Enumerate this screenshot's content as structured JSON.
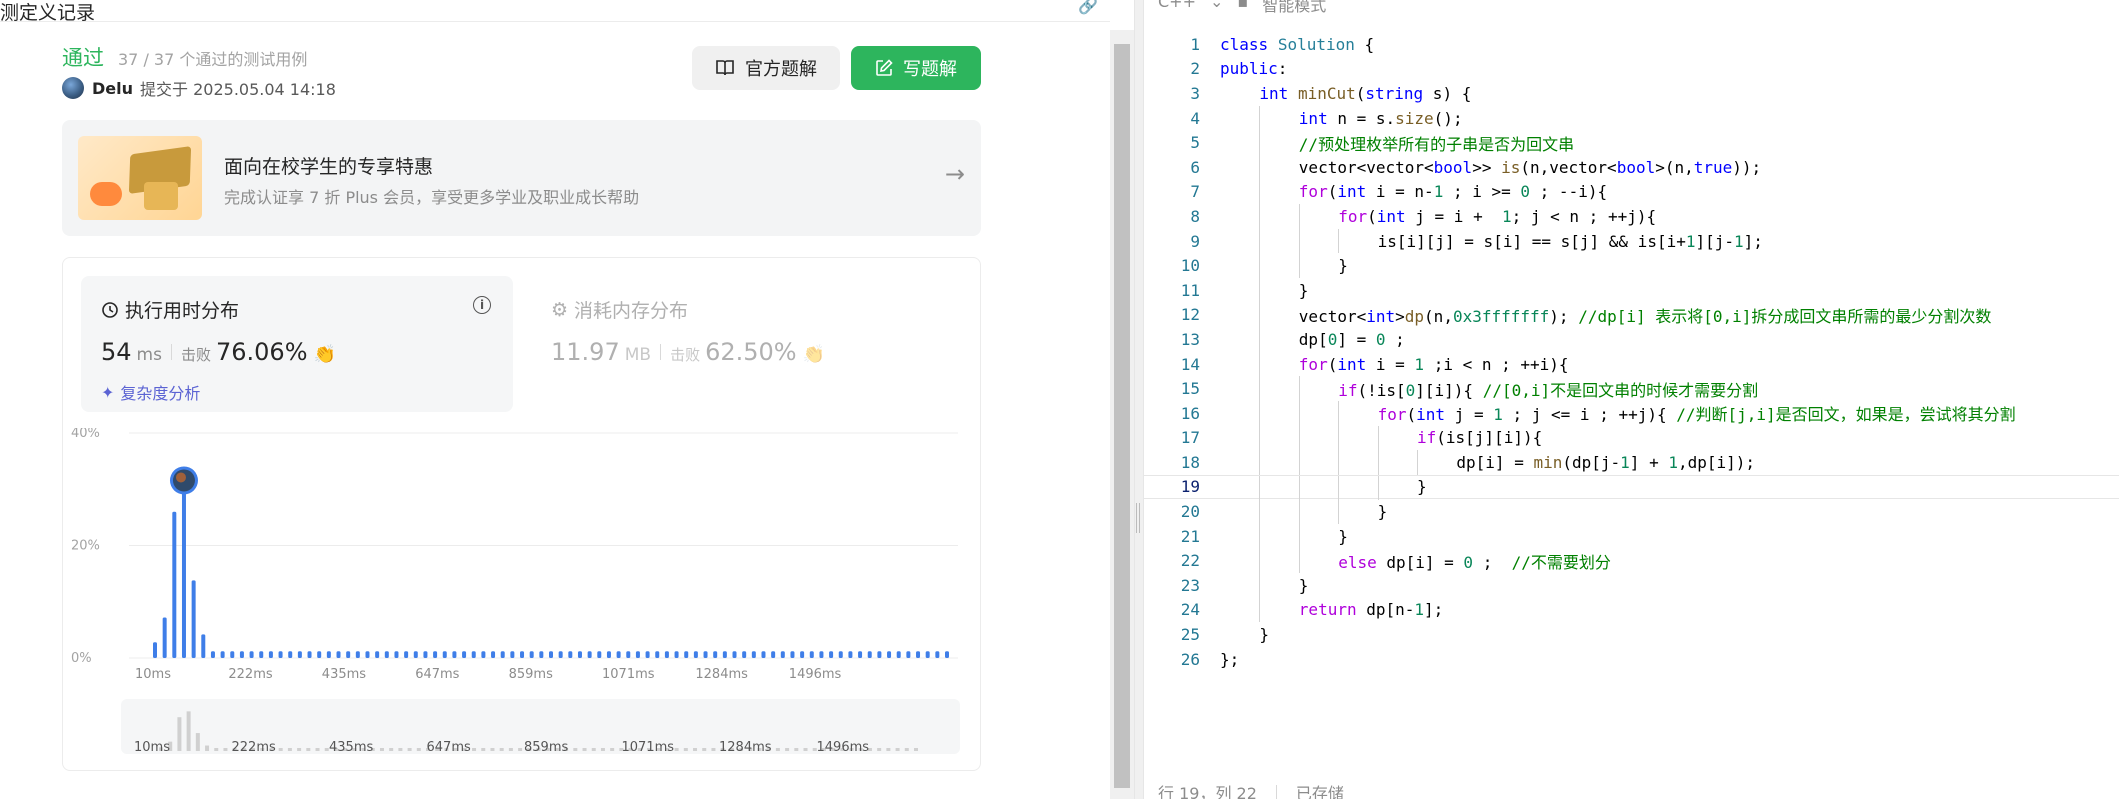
{
  "left": {
    "title": "测定义记录",
    "status": "通过",
    "cases": "37 / 37 个通过的测试用例",
    "user": "Delu",
    "submitted": "提交于 2025.05.04 14:18",
    "btn_official": "官方题解",
    "btn_write": "写题解",
    "promo_title": "面向在校学生的专享特惠",
    "promo_sub": "完成认证享 7 折 Plus 会员，享受更多学业及职业成长帮助",
    "runtime_title": "执行用时分布",
    "runtime_value": "54",
    "runtime_unit": "ms",
    "beat_label": "击败",
    "runtime_beat": "76.06%",
    "complexity": "复杂度分析",
    "memory_title": "消耗内存分布",
    "memory_value": "11.97",
    "memory_unit": "MB",
    "memory_beat": "62.50%"
  },
  "chart_data": {
    "type": "bar",
    "title": "",
    "xlabel": "",
    "ylabel": "",
    "ylim": [
      0,
      40
    ],
    "yticks": [
      "40%",
      "20%",
      "0%"
    ],
    "xtick_labels": [
      "10ms",
      "222ms",
      "435ms",
      "647ms",
      "859ms",
      "1071ms",
      "1284ms",
      "1496ms"
    ],
    "values": [
      2.8,
      7.2,
      26,
      30.5,
      13.8,
      4.2,
      1.2,
      1.2,
      1.2,
      1.2,
      1.2,
      1.2,
      1.2,
      1.2,
      1.2,
      1.2,
      1.2,
      1.2,
      1.2,
      1.2,
      1.2,
      1.2,
      1.2,
      1.2,
      1.2,
      1.2,
      1.2,
      1.2,
      1.2,
      1.2,
      1.2,
      1.2,
      1.2,
      1.2,
      1.2,
      1.2,
      1.2,
      1.2,
      1.2,
      1.2,
      1.2,
      1.2,
      1.2,
      1.2,
      1.2,
      1.2,
      1.2,
      1.2,
      1.2,
      1.2,
      1.2,
      1.2,
      1.2,
      1.2,
      1.2,
      1.2,
      1.2,
      1.2,
      1.2,
      1.2,
      1.2,
      1.2,
      1.2,
      1.2,
      1.2,
      1.2,
      1.2,
      1.2,
      1.2,
      1.2,
      1.2,
      1.2,
      1.2,
      1.2,
      1.2,
      1.2,
      1.2,
      1.2,
      1.2,
      1.2,
      1.2,
      1.2,
      1.2
    ],
    "highlight_index": 3,
    "bar_color": "#3f7ee8",
    "grid": true
  },
  "editor": {
    "top_left": "C++",
    "top_right": "智能模式",
    "status_pos": "行 19，列 22",
    "status_saved": "已存储",
    "current_line": 19,
    "lines": [
      {
        "indent": 0,
        "tokens": [
          [
            "k",
            "class"
          ],
          [
            "",
            " "
          ],
          [
            "t",
            "Solution"
          ],
          [
            "",
            " {"
          ]
        ]
      },
      {
        "indent": 0,
        "tokens": [
          [
            "k",
            "public"
          ],
          [
            "",
            ":"
          ]
        ]
      },
      {
        "indent": 1,
        "tokens": [
          [
            "k",
            "int"
          ],
          [
            "",
            " "
          ],
          [
            "f",
            "minCut"
          ],
          [
            "",
            "("
          ],
          [
            "k",
            "string"
          ],
          [
            "",
            " s) {"
          ]
        ]
      },
      {
        "indent": 2,
        "tokens": [
          [
            "k",
            "int"
          ],
          [
            "",
            " n = s."
          ],
          [
            "f",
            "size"
          ],
          [
            "",
            "();"
          ]
        ]
      },
      {
        "indent": 2,
        "tokens": [
          [
            "c",
            "//预处理枚举所有的子串是否为回文串"
          ]
        ]
      },
      {
        "indent": 2,
        "tokens": [
          [
            "",
            "vector<vector<"
          ],
          [
            "k",
            "bool"
          ],
          [
            "",
            ">> "
          ],
          [
            "f",
            "is"
          ],
          [
            "",
            "(n,vector<"
          ],
          [
            "k",
            "bool"
          ],
          [
            "",
            ">(n,"
          ],
          [
            "k",
            "true"
          ],
          [
            "",
            "));"
          ]
        ]
      },
      {
        "indent": 2,
        "tokens": [
          [
            "ck",
            "for"
          ],
          [
            "",
            "("
          ],
          [
            "k",
            "int"
          ],
          [
            "",
            " i = n-"
          ],
          [
            "n",
            "1"
          ],
          [
            "",
            " ; i >= "
          ],
          [
            "n",
            "0"
          ],
          [
            "",
            " ; --i){"
          ]
        ]
      },
      {
        "indent": 3,
        "tokens": [
          [
            "ck",
            "for"
          ],
          [
            "",
            "("
          ],
          [
            "k",
            "int"
          ],
          [
            "",
            " j = i +  "
          ],
          [
            "n",
            "1"
          ],
          [
            "",
            "; j < n ; ++j){"
          ]
        ]
      },
      {
        "indent": 4,
        "tokens": [
          [
            "",
            "is[i][j] = s[i] == s[j] && is[i+"
          ],
          [
            "n",
            "1"
          ],
          [
            "",
            "][j-"
          ],
          [
            "n",
            "1"
          ],
          [
            "",
            "];"
          ]
        ]
      },
      {
        "indent": 3,
        "tokens": [
          [
            "",
            "}"
          ]
        ]
      },
      {
        "indent": 2,
        "tokens": [
          [
            "",
            "}"
          ]
        ]
      },
      {
        "indent": 2,
        "tokens": [
          [
            "",
            "vector<"
          ],
          [
            "k",
            "int"
          ],
          [
            "",
            ">"
          ],
          [
            "f",
            "dp"
          ],
          [
            "",
            "(n,"
          ],
          [
            "n",
            "0x3fffffff"
          ],
          [
            "",
            "); "
          ],
          [
            "c",
            "//dp[i] 表示将[0,i]拆分成回文串所需的最少分割次数"
          ]
        ]
      },
      {
        "indent": 2,
        "tokens": [
          [
            "",
            "dp["
          ],
          [
            "n",
            "0"
          ],
          [
            "",
            "] = "
          ],
          [
            "n",
            "0"
          ],
          [
            "",
            " ;"
          ]
        ]
      },
      {
        "indent": 2,
        "tokens": [
          [
            "ck",
            "for"
          ],
          [
            "",
            "("
          ],
          [
            "k",
            "int"
          ],
          [
            "",
            " i = "
          ],
          [
            "n",
            "1"
          ],
          [
            "",
            " ;i < n ; ++i){"
          ]
        ]
      },
      {
        "indent": 3,
        "tokens": [
          [
            "ck",
            "if"
          ],
          [
            "",
            "(!is["
          ],
          [
            "n",
            "0"
          ],
          [
            "",
            "][i]){ "
          ],
          [
            "c",
            "//[0,i]不是回文串的时候才需要分割"
          ]
        ]
      },
      {
        "indent": 4,
        "tokens": [
          [
            "ck",
            "for"
          ],
          [
            "",
            "("
          ],
          [
            "k",
            "int"
          ],
          [
            "",
            " j = "
          ],
          [
            "n",
            "1"
          ],
          [
            "",
            " ; j <= i ; ++j){ "
          ],
          [
            "c",
            "//判断[j,i]是否回文，如果是，尝试将其分割"
          ]
        ]
      },
      {
        "indent": 5,
        "tokens": [
          [
            "ck",
            "if"
          ],
          [
            "",
            "(is[j][i]){"
          ]
        ]
      },
      {
        "indent": 6,
        "tokens": [
          [
            "",
            "dp[i] = "
          ],
          [
            "f",
            "min"
          ],
          [
            "",
            "(dp[j-"
          ],
          [
            "n",
            "1"
          ],
          [
            "",
            "] + "
          ],
          [
            "n",
            "1"
          ],
          [
            "",
            ",dp[i]);"
          ]
        ]
      },
      {
        "indent": 5,
        "tokens": [
          [
            "",
            "}"
          ]
        ]
      },
      {
        "indent": 4,
        "tokens": [
          [
            "",
            "}"
          ]
        ]
      },
      {
        "indent": 3,
        "tokens": [
          [
            "",
            "}"
          ]
        ]
      },
      {
        "indent": 3,
        "tokens": [
          [
            "ck",
            "else"
          ],
          [
            "",
            " dp[i] = "
          ],
          [
            "n",
            "0"
          ],
          [
            "",
            " ;  "
          ],
          [
            "c",
            "//不需要划分"
          ]
        ]
      },
      {
        "indent": 2,
        "tokens": [
          [
            "",
            "}"
          ]
        ]
      },
      {
        "indent": 2,
        "tokens": [
          [
            "ck",
            "return"
          ],
          [
            "",
            " dp[n-"
          ],
          [
            "n",
            "1"
          ],
          [
            "",
            "];"
          ]
        ]
      },
      {
        "indent": 1,
        "tokens": [
          [
            "",
            "}"
          ]
        ]
      },
      {
        "indent": 0,
        "tokens": [
          [
            "",
            "};"
          ]
        ]
      }
    ]
  }
}
